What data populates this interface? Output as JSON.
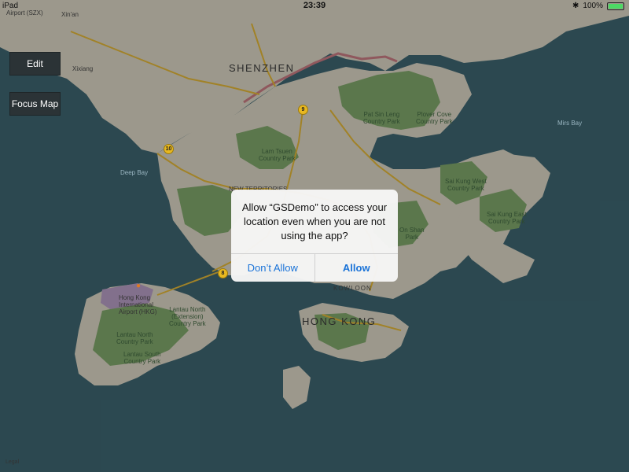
{
  "status_bar": {
    "left": "iPad",
    "time": "23:39",
    "battery": "100%"
  },
  "controls": {
    "edit_label": "Edit",
    "focus_map_label": "Focus Map"
  },
  "map": {
    "labels": {
      "airport_szx": "Airport (SZX)",
      "xinan": "Xin'an",
      "xixiang": "Xixiang",
      "shenzhen": "SHENZHEN",
      "pat_sin_leng": "Pat Sin Leng\nCountry Park",
      "plover_cove": "Plover Cove\nCountry Park",
      "mirs_bay": "Mirs Bay",
      "deep_bay": "Deep Bay",
      "lam_tsuen": "Lam Tsuen\nCountry Park",
      "new_territories": "NEW TERRITORIES",
      "sai_kung_west": "Sai Kung West\nCountry Park",
      "sai_kung_east": "Sai Kung East\nCountry Park",
      "ma_on_shan": "On Shan\nPark",
      "kowloon": "KOWLOON",
      "hong_kong": "HONG KONG",
      "hk_airport": "Hong Kong\nInternational\nAirport (HKG)",
      "lantau_north": "Lantau North\n(Extension)\nCountry Park",
      "lantau_north2": "Lantau North\nCountry Park",
      "lantau_south": "Lantau South\nCountry Park",
      "legal": "Legal"
    },
    "route_shields": [
      "9",
      "10",
      "8"
    ],
    "colors": {
      "water": "#3d6570",
      "land": "#d9d3c3",
      "park": "#7fa56a",
      "road": "#e0b436",
      "border": "#c77a82"
    }
  },
  "alert": {
    "message": "Allow “GSDemo” to access your location even when you are not using the app?",
    "deny_label": "Don’t Allow",
    "allow_label": "Allow"
  }
}
